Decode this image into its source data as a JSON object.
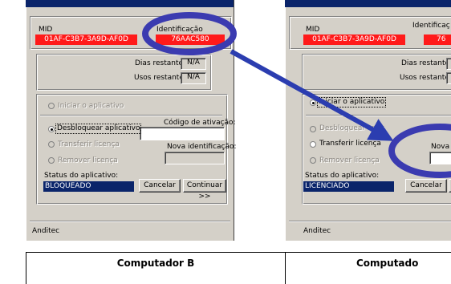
{
  "left_dialog": {
    "mid_label": "MID",
    "mid_value": "01AF-C3B7-3A9D-AF0D",
    "identificacao_label": "Identificação",
    "identificacao_value": "76AAC580",
    "dias_restantes_label": "Dias restantes:",
    "dias_restantes_value": "N/A",
    "usos_restantes_label": "Usos restantes:",
    "usos_restantes_value": "N/A",
    "iniciar_label": "Iniciar o aplicativo",
    "codigo_label": "Código de ativação:",
    "desbloquear_label": "Desbloquear aplicativo",
    "transferir_label": "Transferir licença",
    "nova_id_label": "Nova identificação:",
    "remover_label": "Remover licença",
    "status_label": "Status do aplicativo:",
    "status_value": "BLOQUEADO",
    "cancelar_label": "Cancelar",
    "continuar_label": "Continuar >>",
    "footer_text": "Anditec"
  },
  "right_dialog": {
    "mid_label": "MID",
    "mid_value": "01AF-C3B7-3A9D-AF0D",
    "identificacao_label": "Identificaç",
    "identificacao_value": "76",
    "dias_restantes_label": "Dias restantes:",
    "usos_restantes_label": "Usos restantes:",
    "iniciar_label": "Iniciar o aplicativo",
    "desbloquear_label": "Desbloquear aplic",
    "transferir_label": "Transferir licença",
    "nova_label": "Nova i",
    "remover_label": "Remover licença",
    "status_label": "Status do aplicativo:",
    "status_value": "LICENCIADO",
    "cancelar_label": "Cancelar",
    "footer_text": "Anditec"
  },
  "captions": {
    "left": "Computador B",
    "right": "Computado"
  },
  "colors": {
    "highlight_ellipse": "#3b3bb0",
    "arrow": "#2b3db0",
    "red_field": "#ff1a1a",
    "status_bg": "#0a246a"
  }
}
